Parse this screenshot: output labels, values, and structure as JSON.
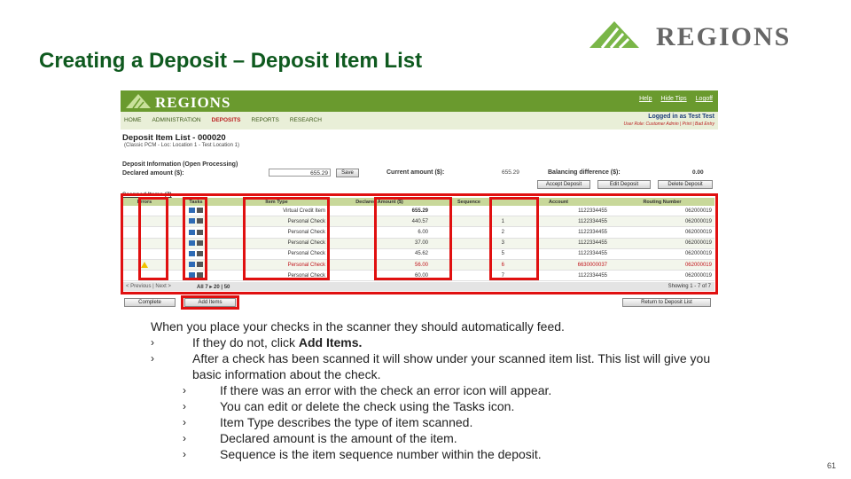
{
  "slide": {
    "title": "Creating a Deposit – Deposit Item List",
    "brand": "REGIONS",
    "page_number": "61"
  },
  "screenshot": {
    "logo": "REGIONS",
    "header_links": [
      "Help",
      "Hide Tips",
      "Logoff"
    ],
    "nav": [
      "HOME",
      "ADMINISTRATION",
      "DEPOSITS",
      "REPORTS",
      "RESEARCH"
    ],
    "logged_in": "Logged in as Test Test",
    "logged_sub": "User Role: Customer Admin | Print | Bad Entry",
    "page_title": "Deposit Item List - 000020",
    "page_sub": "(Classic PCM - Loc: Location 1 - Test Location 1)",
    "info_title": "Deposit Information (Open Processing)",
    "declared_label": "Declared amount ($):",
    "declared_value": "655.29",
    "save_label": "Save",
    "current_label": "Current amount ($):",
    "current_value": "655.29",
    "balance_label": "Balancing difference ($):",
    "balance_value": "0.00",
    "actions": [
      "Accept Deposit",
      "Edit Deposit",
      "Delete Deposit"
    ],
    "scanned_title": "Scanned Items (7)",
    "columns": [
      "Errors",
      "Tasks",
      "Item Type",
      "Declared Amount ($)",
      "Sequence",
      "Account",
      "Routing Number"
    ],
    "rows": [
      {
        "error": false,
        "type": "Virtual Credit Item",
        "amount": "655.29",
        "seq": "",
        "account": "1122334455",
        "routing": "062000019",
        "red": false,
        "bold": true
      },
      {
        "error": false,
        "type": "Personal Check",
        "amount": "440.57",
        "seq": "1",
        "account": "1122334455",
        "routing": "062000019",
        "red": false,
        "bold": false
      },
      {
        "error": false,
        "type": "Personal Check",
        "amount": "6.00",
        "seq": "2",
        "account": "1122334455",
        "routing": "062000019",
        "red": false,
        "bold": false
      },
      {
        "error": false,
        "type": "Personal Check",
        "amount": "37.00",
        "seq": "3",
        "account": "1122334455",
        "routing": "062000019",
        "red": false,
        "bold": false
      },
      {
        "error": false,
        "type": "Personal Check",
        "amount": "45.62",
        "seq": "5",
        "account": "1122334455",
        "routing": "062000019",
        "red": false,
        "bold": false
      },
      {
        "error": true,
        "type": "Personal Check",
        "amount": "56.00",
        "seq": "6",
        "account": "6630000037",
        "routing": "062000019",
        "red": true,
        "bold": false
      },
      {
        "error": false,
        "type": "Personal Check",
        "amount": "60.00",
        "seq": "7",
        "account": "1122334455",
        "routing": "062000019",
        "red": false,
        "bold": false
      }
    ],
    "pager_left": "< Previous | Next >",
    "pager_mid": "All 7 ▸ 20 | 50",
    "pager_right": "Showing 1 - 7 of 7",
    "complete_label": "Complete",
    "add_items_label": "Add Items",
    "return_label": "Return to Deposit List"
  },
  "body": {
    "intro": "When you place your checks in the scanner they should automatically feed.",
    "bullet1_prefix": "If they do not,  click ",
    "bullet1_bold": "Add Items.",
    "bullet2": "After a check has been scanned it will show under your scanned item list.  This list will give you basic information about the check.",
    "sub_bullets": [
      "If there was an error with the check an error icon will appear.",
      "You can edit or delete the check using the Tasks icon.",
      "Item Type describes the type of item scanned.",
      "Declared amount  is the amount of the item.",
      "Sequence is the item sequence number within the deposit."
    ]
  },
  "colors": {
    "title_green": "#0f5a1f",
    "regions_green": "#7ab648",
    "highlight_red": "#e01010"
  }
}
